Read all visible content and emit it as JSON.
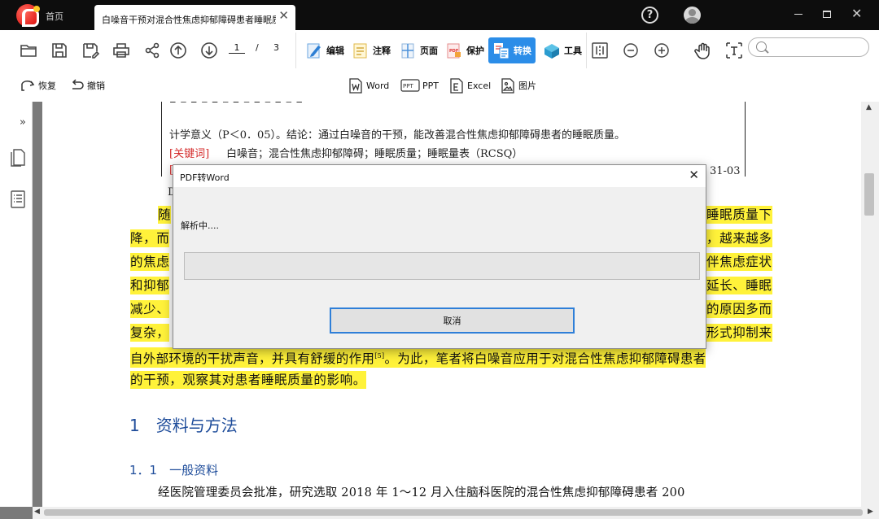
{
  "titlebar": {
    "home_tab": "首页",
    "doc_tab_title": "白噪音干预对混合性焦虑抑郁障碍患者睡眠质...",
    "help": "?"
  },
  "toolbar": {
    "page_current": "1",
    "page_separator": "/",
    "page_total": "3",
    "modes": [
      {
        "label": "编辑",
        "icon": "edit-icon"
      },
      {
        "label": "注释",
        "icon": "comment-icon"
      },
      {
        "label": "页面",
        "icon": "page-icon"
      },
      {
        "label": "保护",
        "icon": "protect-icon"
      },
      {
        "label": "转换",
        "icon": "convert-icon",
        "active": true
      },
      {
        "label": "工具",
        "icon": "tools-icon"
      }
    ],
    "search_placeholder": ""
  },
  "subbar": {
    "redo_label": "恢复",
    "undo_label": "撤销",
    "convert_options": [
      "Word",
      "PPT",
      "Excel",
      "图片"
    ],
    "ppt_icon_text": "PPT"
  },
  "colors": {
    "accent": "#2b8de8",
    "highlight": "#fff23a",
    "heading": "#1e4c9a",
    "keyword_red": "#d42a2a"
  },
  "document": {
    "abstract_line1": "计学意义（P＜0．05）。结论：通过白噪音的干预，能改善混合性焦虑抑郁障碍患者的睡眠质量。",
    "keywords_label": "[关键词]",
    "keywords_text": "白噪音；混合性焦虑抑郁障碍；睡眠质量；睡眠量表（RCSQ）",
    "partial_left_bracket": "[",
    "partial_date": "31-03",
    "partial_left_d": "D",
    "para_lines": [
      {
        "left": "随",
        "right": "睡眠质量下"
      },
      {
        "left": "降，而",
        "right": "，越来越多"
      },
      {
        "left": "的焦虑",
        "right": "伴焦虑症状"
      },
      {
        "left": "和抑郁",
        "right": "延长、睡眠"
      },
      {
        "left": "减少、",
        "right": "的原因多而"
      },
      {
        "left": "复杂，",
        "right": "形式抑制来"
      }
    ],
    "line7": "自外部环境的干扰声音，并具有舒缓的作用",
    "line7_ref": "[5]",
    "line7_rest": "。为此，笔者将白噪音应用于对混合性焦虑抑郁障碍患者",
    "line8": "的干预，观察其对患者睡眠质量的影响。",
    "section1": "1　资料与方法",
    "section1_1": "1．1　一般资料",
    "line_last": "经医院管理委员会批准，研究选取 2018 年 1～12 月入住脑科医院的混合性焦虑抑郁障碍患者 200"
  },
  "dialog": {
    "title": "PDF转Word",
    "status": "解析中....",
    "progress": 0.0,
    "cancel_label": "取消"
  }
}
